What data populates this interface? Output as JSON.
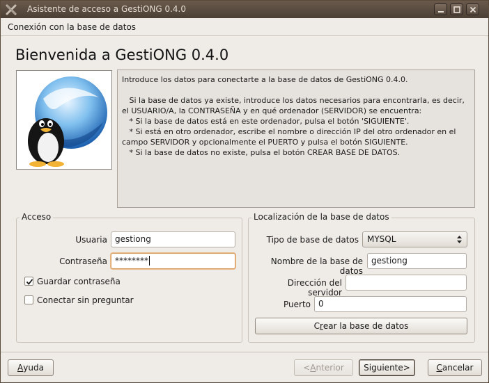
{
  "window": {
    "title": "Asistente de acceso a GestiONG 0.4.0"
  },
  "header": {
    "breadcrumb": "Conexión con la base de datos"
  },
  "page": {
    "title": "Bienvenida a GestiONG 0.4.0"
  },
  "info": {
    "lines": [
      "Introduce los datos para conectarte a la base de datos de GestiONG 0.4.0.",
      "",
      "   Si la base de datos ya existe, introduce los datos necesarios para encontrarla, es decir,",
      "el USUARIO/A, la CONTRASEÑA y en qué ordenador (SERVIDOR) se encuentra:",
      "   * Si la base de datos está en este ordenador, pulsa el botón 'SIGUIENTE'.",
      "   * Si está en otro ordenador, escribe el nombre o dirección IP del otro ordenador en el",
      "campo SERVIDOR y opcionalmente el PUERTO y pulsa el botón SIGUIENTE.",
      "   * Si la base de datos no existe, pulsa el botón CREAR BASE DE DATOS."
    ]
  },
  "acceso": {
    "legend": "Acceso",
    "usuario_label": "Usuaria",
    "usuario_value": "gestiong",
    "password_label": "Contraseña",
    "password_value": "********",
    "guardar_label": "Guardar contraseña",
    "guardar_checked": true,
    "conectar_label": "Conectar sin preguntar",
    "conectar_checked": false
  },
  "localizacion": {
    "legend": "Localización de la base de datos",
    "tipo_label": "Tipo de base de datos",
    "tipo_value": "MYSQL",
    "nombre_label": "Nombre de la base de datos",
    "nombre_value": "gestiong",
    "direccion_label": "Dirección del servidor",
    "direccion_value": "",
    "puerto_label": "Puerto",
    "puerto_value": "0",
    "crear_pre": "C",
    "crear_u": "r",
    "crear_post": "ear la base de datos"
  },
  "footer": {
    "ayuda_u": "A",
    "ayuda_post": "yuda",
    "anterior_pre": "< ",
    "anterior_u": "A",
    "anterior_post": "nterior",
    "siguiente_pre": "Siguiente",
    "siguiente_post": " >",
    "cancelar_u": "C",
    "cancelar_post": "ancelar"
  },
  "colors": {
    "titlebar": "#4b3f35",
    "window_bg": "#efebe7",
    "focus": "#d79b5e"
  }
}
